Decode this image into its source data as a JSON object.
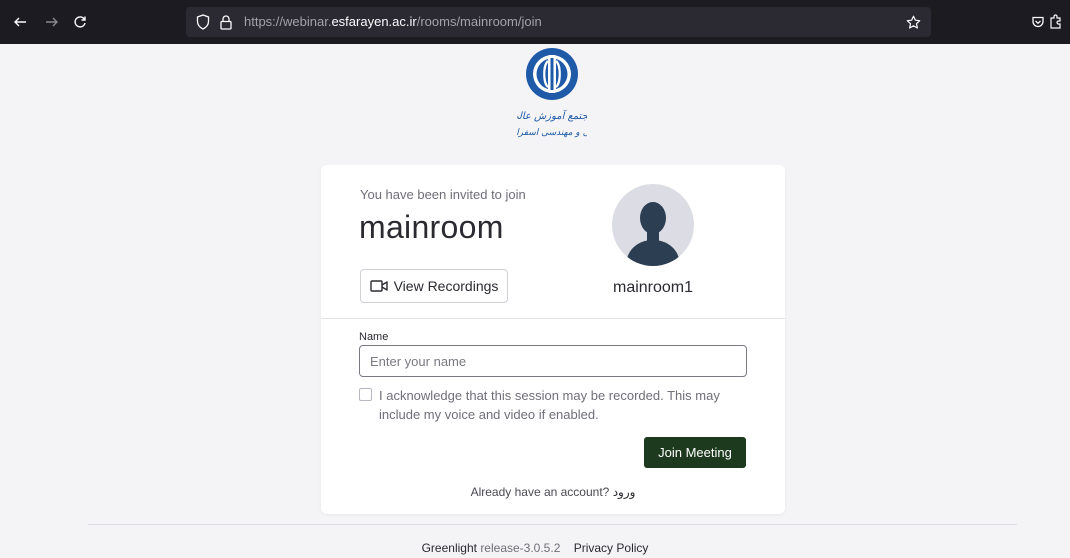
{
  "browser": {
    "url_prefix": "https://webinar.",
    "url_domain": "esfarayen.ac.ir",
    "url_path": "/rooms/mainroom/join"
  },
  "logo": {
    "text_line1": "مجتمع آموزش عالی",
    "text_line2": "فنی و مهندسی اسفراین"
  },
  "room": {
    "invite_text": "You have been invited to join",
    "title": "mainroom",
    "view_recordings_label": "View Recordings",
    "owner_name": "mainroom1"
  },
  "form": {
    "name_label": "Name",
    "name_value": "",
    "name_placeholder": "Enter your name",
    "acknowledge_text": "I acknowledge that this session may be recorded. This may include my voice and video if enabled.",
    "acknowledge_checked": false,
    "join_button_label": "Join Meeting"
  },
  "signin": {
    "prompt": "Already have an account?",
    "link_label": "ورود"
  },
  "footer": {
    "brand": "Greenlight",
    "release": "release-3.0.5.2",
    "privacy_label": "Privacy Policy"
  },
  "colors": {
    "browser_bar": "#1c1b22",
    "urlbar": "#2b2a33",
    "join_button": "#1d3a1f",
    "logo_blue": "#1f5aa8"
  },
  "icons": [
    "back-arrow-icon",
    "forward-arrow-icon",
    "reload-icon",
    "shield-icon",
    "lock-icon",
    "star-icon",
    "pocket-icon",
    "extensions-icon",
    "video-camera-icon",
    "user-silhouette-icon"
  ]
}
